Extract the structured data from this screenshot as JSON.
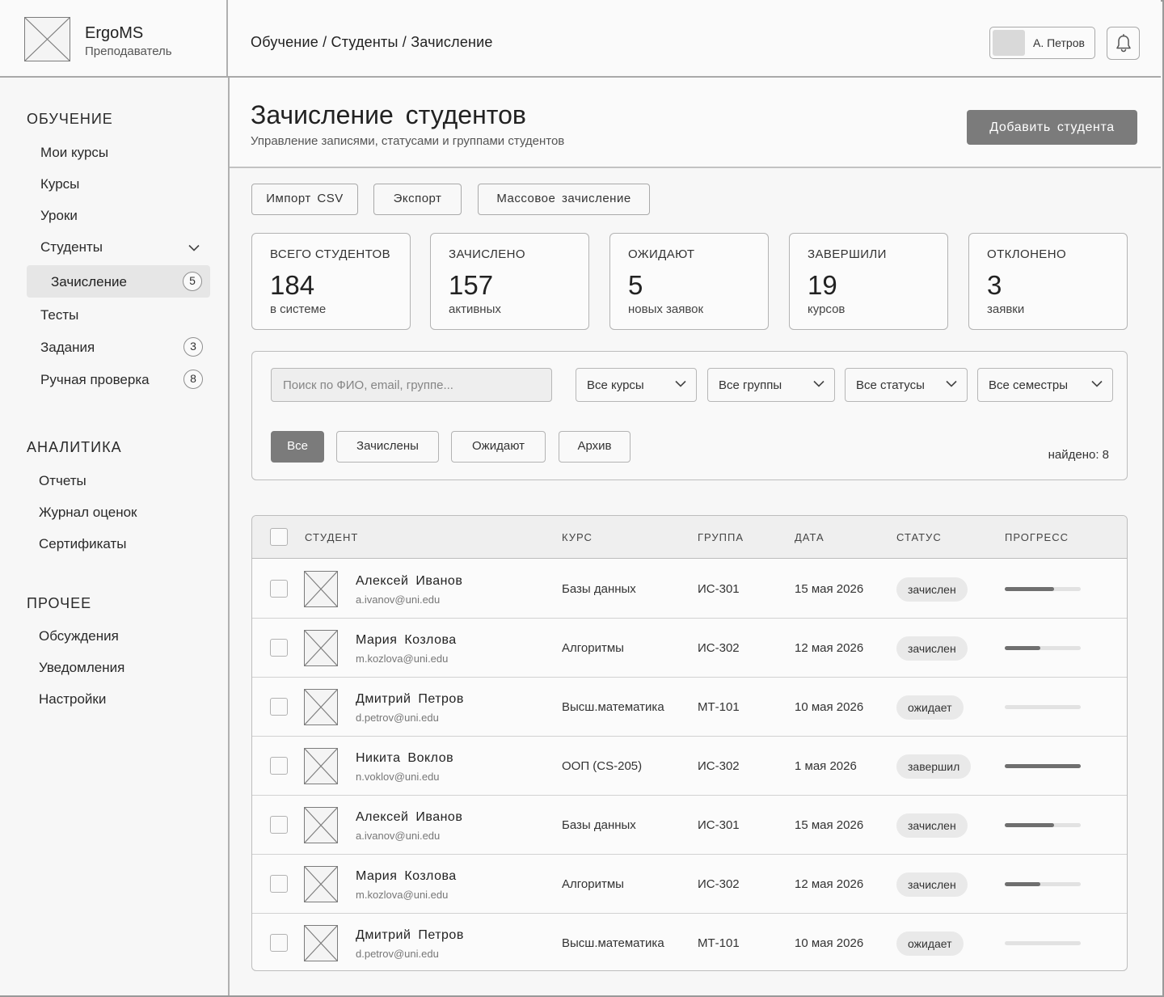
{
  "app": {
    "name": "ErgoMS",
    "role": "Преподаватель"
  },
  "header": {
    "breadcrumb": "Обучение / Студенты / Зачисление",
    "user_name": "А. Петров"
  },
  "sidebar": {
    "sections": [
      {
        "title": "ОБУЧЕНИЕ"
      },
      {
        "title": "АНАЛИТИКА"
      },
      {
        "title": "ПРОЧЕЕ"
      }
    ],
    "items": [
      {
        "label": "Мои курсы"
      },
      {
        "label": "Курсы"
      },
      {
        "label": "Уроки"
      },
      {
        "label": "Студенты"
      },
      {
        "label": "Зачисление",
        "badge": "5"
      },
      {
        "label": "Тесты"
      },
      {
        "label": "Задания",
        "badge": "3"
      },
      {
        "label": "Ручная проверка",
        "badge": "8"
      },
      {
        "label": "Отчеты"
      },
      {
        "label": "Журнал оценок"
      },
      {
        "label": "Сертификаты"
      },
      {
        "label": "Обсуждения"
      },
      {
        "label": "Уведомления"
      },
      {
        "label": "Настройки"
      }
    ]
  },
  "page": {
    "title": "Зачисление студентов",
    "subtitle": "Управление записями, статусами и группами студентов",
    "add_button": "Добавить студента"
  },
  "toolbar": {
    "import": "Импорт CSV",
    "export": "Экспорт",
    "bulk": "Массовое зачисление"
  },
  "stats": [
    {
      "label": "ВСЕГО СТУДЕНТОВ",
      "value": "184",
      "sub": "в системе"
    },
    {
      "label": "ЗАЧИСЛЕНО",
      "value": "157",
      "sub": "активных"
    },
    {
      "label": "ОЖИДАЮТ",
      "value": "5",
      "sub": "новых заявок"
    },
    {
      "label": "ЗАВЕРШИЛИ",
      "value": "19",
      "sub": "курсов"
    },
    {
      "label": "ОТКЛОНЕНО",
      "value": "3",
      "sub": "заявки"
    }
  ],
  "filters": {
    "search_placeholder": "Поиск по ФИО, email, группе...",
    "selects": [
      "Все курсы",
      "Все группы",
      "Все статусы",
      "Все семестры"
    ],
    "tabs": [
      "Все",
      "Зачислены",
      "Ожидают",
      "Архив"
    ],
    "active_tab": "Все",
    "found": "найдено: 8"
  },
  "table": {
    "columns": [
      "СТУДЕНТ",
      "КУРС",
      "ГРУППА",
      "ДАТА",
      "СТАТУС",
      "ПРОГРЕСС"
    ],
    "rows": [
      {
        "name": "Алексей Иванов",
        "email": "a.ivanov@uni.edu",
        "course": "Базы данных",
        "group": "ИС-301",
        "date": "15 мая 2026",
        "status": "зачислен",
        "progress": 0.65
      },
      {
        "name": "Мария Козлова",
        "email": "m.kozlova@uni.edu",
        "course": "Алгоритмы",
        "group": "ИС-302",
        "date": "12 мая 2026",
        "status": "зачислен",
        "progress": 0.47
      },
      {
        "name": "Дмитрий Петров",
        "email": "d.petrov@uni.edu",
        "course": "Высш.математика",
        "group": "МТ-101",
        "date": "10 мая 2026",
        "status": "ожидает",
        "progress": 0
      },
      {
        "name": "Никита Воклов",
        "email": "n.voklov@uni.edu",
        "course": "ООП (CS-205)",
        "group": "ИС-302",
        "date": "1 мая 2026",
        "status": "завершил",
        "progress": 1.0
      },
      {
        "name": "Алексей Иванов",
        "email": "a.ivanov@uni.edu",
        "course": "Базы данных",
        "group": "ИС-301",
        "date": "15 мая 2026",
        "status": "зачислен",
        "progress": 0.65
      },
      {
        "name": "Мария Козлова",
        "email": "m.kozlova@uni.edu",
        "course": "Алгоритмы",
        "group": "ИС-302",
        "date": "12 мая 2026",
        "status": "зачислен",
        "progress": 0.47
      },
      {
        "name": "Дмитрий Петров",
        "email": "d.petrov@uni.edu",
        "course": "Высш.математика",
        "group": "МТ-101",
        "date": "10 мая 2026",
        "status": "ожидает",
        "progress": 0
      }
    ]
  },
  "icons": {
    "logo": "image-placeholder-icon",
    "notifications": "bell-icon",
    "expand": "chevron-down-icon",
    "avatar": "image-placeholder-icon"
  },
  "colors": {
    "primary_button": "#7b7b7b",
    "active_nav": "#e6e6e6",
    "status_pill": "#e9e9e9",
    "progress_fill": "#6f6f6f"
  }
}
